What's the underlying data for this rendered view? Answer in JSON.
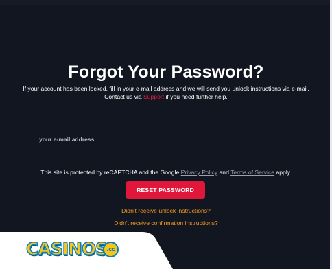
{
  "page": {
    "title": "Forgot Your Password?",
    "info_line1": "If your account has been locked, fill in your e-mail address and we will send you unlock instructions via e-mail.",
    "info_line2_before": "Contact us via ",
    "info_support_link": "Support",
    "info_line2_after": " if you need further help."
  },
  "form": {
    "email_placeholder": "your e-mail address",
    "recaptcha_before": "This site is protected by reCAPTCHA and the Google ",
    "privacy_policy_link": "Privacy Policy",
    "recaptcha_and": " and ",
    "terms_link": "Terms of Service",
    "recaptcha_after": " apply.",
    "reset_button": "RESET PASSWORD",
    "unlock_link": "Didn't receive unlock instructions?",
    "confirmation_link": "Didn't receive confirmation instructions?"
  },
  "logo": {
    "text": "CASINOS",
    "suffix": ".cc"
  },
  "colors": {
    "background": "#121621",
    "accent_red": "#e0173a",
    "link_orange": "#f39a1c",
    "logo_yellow": "#f6c519",
    "logo_blue": "#0a7fbe"
  }
}
